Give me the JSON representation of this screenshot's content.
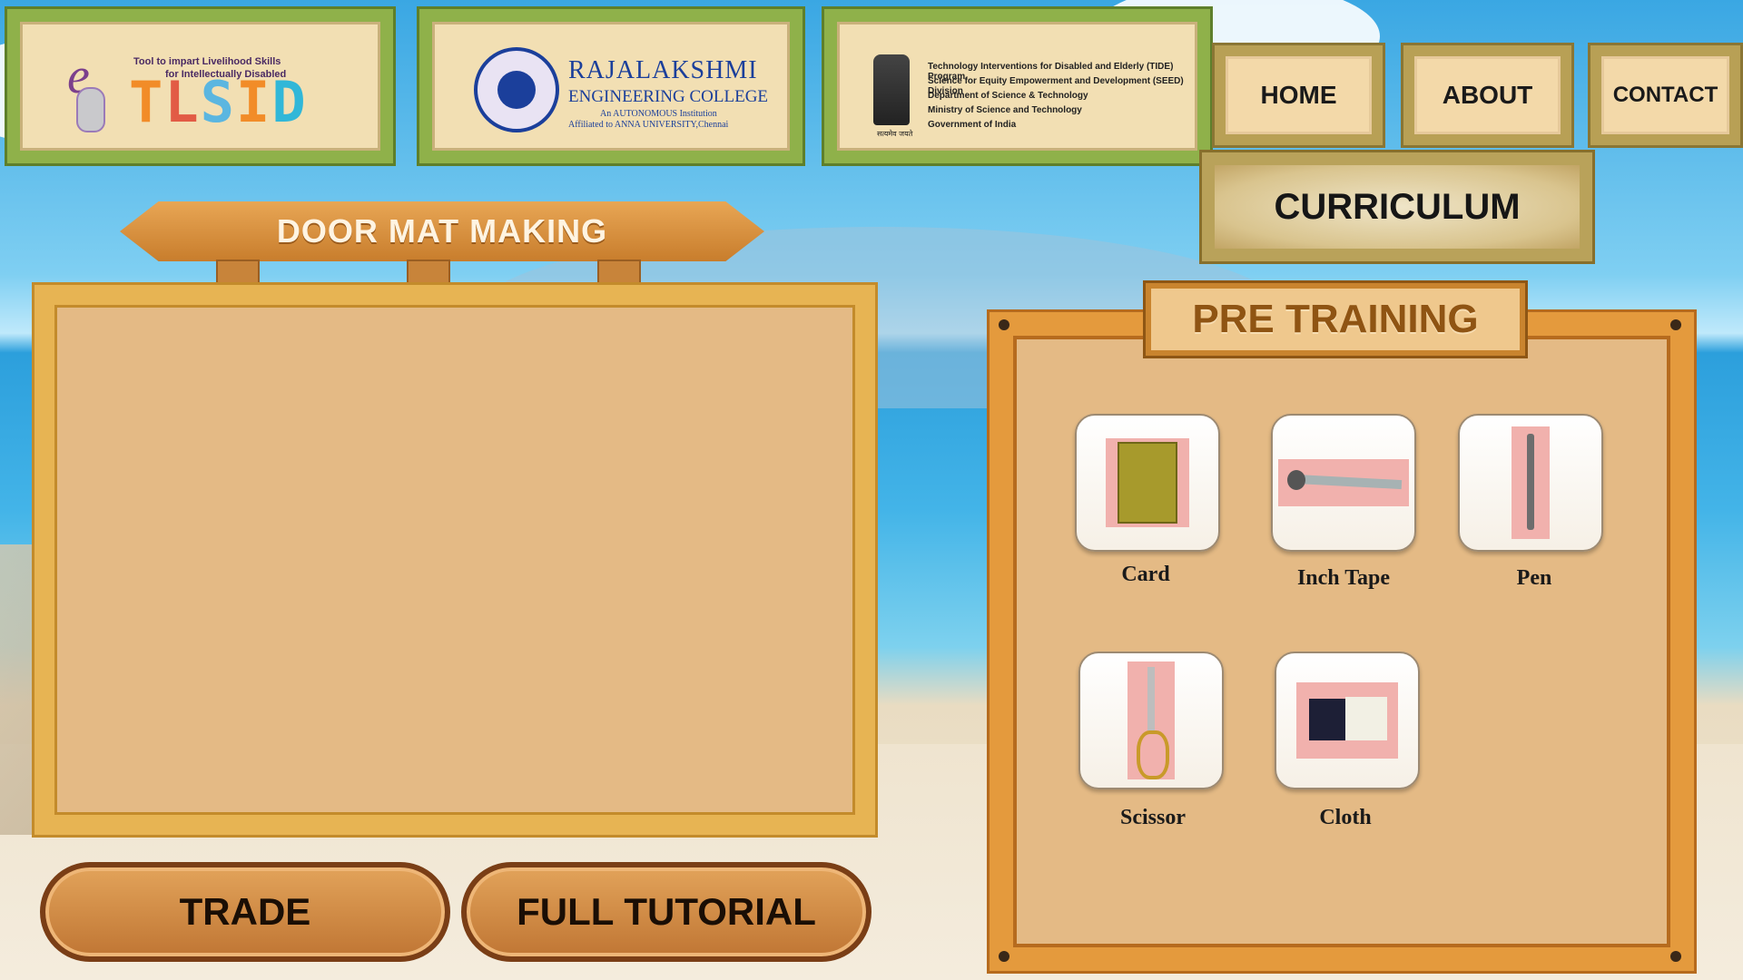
{
  "header": {
    "logo_tlsid": {
      "tagline_line1": "Tool to impart Livelihood Skills",
      "tagline_line2": "for Intellectually Disabled",
      "e_mark": "e",
      "title_letters": [
        "T",
        "L",
        "S",
        "I",
        "D"
      ]
    },
    "logo_rec": {
      "title": "RAJALAKSHMI",
      "subtitle": "ENGINEERING COLLEGE",
      "autonomous": "An AUTONOMOUS Institution",
      "affiliation": "Affiliated to ANNA UNIVERSITY,Chennai"
    },
    "logo_dst": {
      "lines": [
        "Technology Interventions for Disabled and Elderly (TIDE) Program",
        "Science for Equity Empowerment and Development (SEED) Division",
        "Department of Science & Technology",
        "Ministry of Science and Technology",
        "Government of India"
      ],
      "emblem_caption": "सत्यमेव जयते"
    }
  },
  "nav": {
    "home": "HOME",
    "about": "ABOUT",
    "contact": "CONTACT",
    "curriculum": "CURRICULUM"
  },
  "main": {
    "signpost_title": "DOOR MAT MAKING",
    "buttons": {
      "trade": "TRADE",
      "full_tutorial": "FULL TUTORIAL"
    }
  },
  "pretraining": {
    "title": "PRE TRAINING",
    "items": [
      {
        "label": "Card",
        "icon": "card-photo"
      },
      {
        "label": "Inch Tape",
        "icon": "inch-tape-photo"
      },
      {
        "label": "Pen",
        "icon": "pen-photo"
      },
      {
        "label": "Scissor",
        "icon": "scissor-photo"
      },
      {
        "label": "Cloth",
        "icon": "cloth-photo"
      }
    ]
  },
  "colors": {
    "bamboo_green": "#8fb14a",
    "wood_orange": "#e49a3d",
    "board_fill": "#e4ba85",
    "sky_blue": "#3aa7e3"
  }
}
